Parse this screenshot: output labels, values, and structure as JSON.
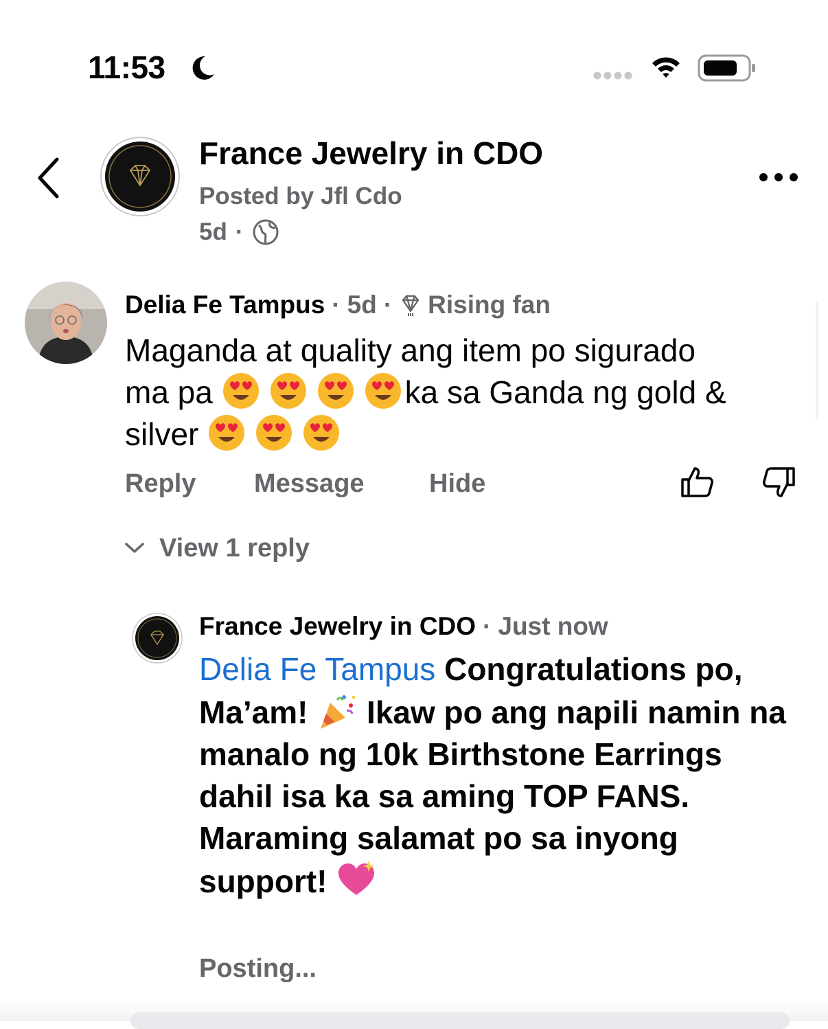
{
  "status_bar": {
    "time": "11:53",
    "icons": [
      "moon-icon",
      "signal-dots-icon",
      "wifi-icon",
      "battery-icon"
    ]
  },
  "header": {
    "title": "France Jewelry in CDO",
    "posted_by": "Posted by Jfl Cdo",
    "age": "5d",
    "separator": "·",
    "icons": [
      "back-chevron-icon",
      "globe-icon",
      "more-options-icon"
    ]
  },
  "comment": {
    "author": "Delia Fe Tampus",
    "age": "5d",
    "separator": "·",
    "badge": "Rising fan",
    "text_line1": "Maganda at quality ang item po sigurado",
    "text_line2_before": "ma pa",
    "text_line2_after": "ka sa Ganda ng gold &",
    "text_line3": "silver",
    "actions": {
      "reply": "Reply",
      "message": "Message",
      "hide": "Hide"
    },
    "view_replies": "View 1 reply"
  },
  "reply": {
    "author": "France Jewelry in CDO",
    "age": "Just now",
    "separator": "·",
    "mention": "Delia Fe Tampus",
    "text_a": " Congratulations po, Ma’am! ",
    "text_b": " Ikaw po ang napili namin na manalo ng 10k Birthstone Earrings dahil isa ka sa aming TOP FANS.",
    "text_c": "Maraming salamat po sa inyong support! ",
    "status": "Posting..."
  },
  "colors": {
    "text": "#050505",
    "secondary": "#65676b",
    "mention": "#1b6fd2",
    "emoji_face": "#f9b82c"
  }
}
